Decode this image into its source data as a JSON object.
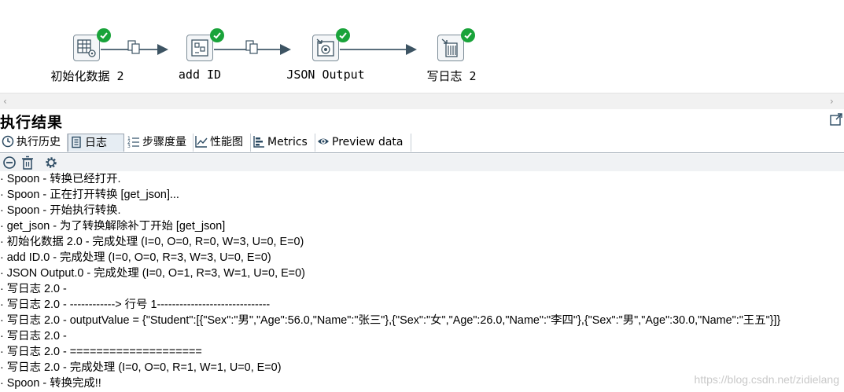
{
  "canvas": {
    "steps": [
      {
        "label": "初始化数据 2",
        "icon": "generate-rows-icon",
        "status": "ok"
      },
      {
        "label": "add ID",
        "icon": "add-sequence-icon",
        "status": "ok"
      },
      {
        "label": "JSON Output",
        "icon": "json-output-icon",
        "status": "ok"
      },
      {
        "label": "写日志 2",
        "icon": "write-log-icon",
        "status": "ok"
      }
    ]
  },
  "results": {
    "title": "执行结果",
    "tabs": [
      {
        "label": "执行历史",
        "icon": "history-icon",
        "active": false
      },
      {
        "label": "日志",
        "icon": "log-icon",
        "active": true
      },
      {
        "label": "步骤度量",
        "icon": "step-metrics-icon",
        "active": false
      },
      {
        "label": "性能图",
        "icon": "performance-graph-icon",
        "active": false
      },
      {
        "label": "Metrics",
        "icon": "metrics-icon",
        "active": false
      },
      {
        "label": "Preview data",
        "icon": "eye-icon",
        "active": false
      }
    ],
    "toolbar": [
      "clear-log-icon",
      "trash-icon",
      "gear-icon"
    ]
  },
  "log": [
    "· Spoon - 转换已经打开.",
    "· Spoon - 正在打开转换 [get_json]...",
    "· Spoon - 开始执行转换.",
    "· get_json - 为了转换解除补丁开始  [get_json]",
    "· 初始化数据 2.0 - 完成处理 (I=0, O=0, R=0, W=3, U=0, E=0)",
    "· add ID.0 - 完成处理 (I=0, O=0, R=3, W=3, U=0, E=0)",
    "· JSON Output.0 - 完成处理 (I=0, O=1, R=3, W=1, U=0, E=0)",
    "· 写日志 2.0 -",
    "· 写日志 2.0 - ------------> 行号 1------------------------------",
    "· 写日志 2.0 - outputValue = {\"Student\":[{\"Sex\":\"男\",\"Age\":56.0,\"Name\":\"张三\"},{\"Sex\":\"女\",\"Age\":26.0,\"Name\":\"李四\"},{\"Sex\":\"男\",\"Age\":30.0,\"Name\":\"王五\"}]}",
    "· 写日志 2.0 -",
    "· 写日志 2.0 - ====================",
    "· 写日志 2.0 - 完成处理 (I=0, O=0, R=1, W=1, U=0, E=0)",
    "· Spoon - 转换完成!!"
  ],
  "watermark": "https://blog.csdn.net/zidielang"
}
